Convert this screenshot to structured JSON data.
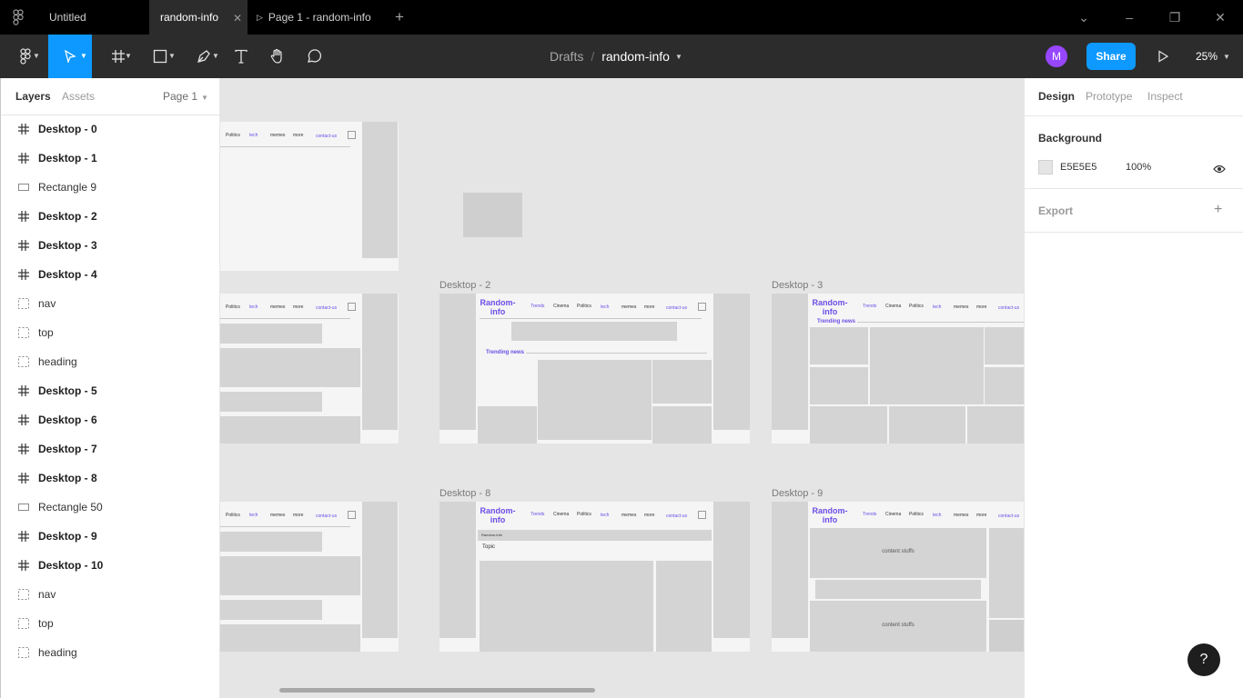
{
  "titlebar": {
    "tabs": [
      "Untitled",
      "random-info",
      "Page 1 - random-info"
    ],
    "close_glyph": "✕",
    "plus_glyph": "+",
    "window_controls": [
      "⌄",
      "–",
      "❐",
      "✕"
    ]
  },
  "toolbar": {
    "breadcrumb_drafts": "Drafts",
    "breadcrumb_sep": "/",
    "file_name": "random-info",
    "avatar_initial": "M",
    "share_label": "Share",
    "zoom": "25%"
  },
  "left_panel": {
    "tab_layers": "Layers",
    "tab_assets": "Assets",
    "page_select": "Page 1",
    "layers": [
      {
        "type": "frame",
        "name": "Desktop - 0"
      },
      {
        "type": "frame",
        "name": "Desktop - 1"
      },
      {
        "type": "rect",
        "name": "Rectangle 9"
      },
      {
        "type": "frame",
        "name": "Desktop - 2"
      },
      {
        "type": "frame",
        "name": "Desktop - 3"
      },
      {
        "type": "frame",
        "name": "Desktop - 4"
      },
      {
        "type": "group",
        "name": "nav"
      },
      {
        "type": "group",
        "name": "top"
      },
      {
        "type": "group",
        "name": "heading"
      },
      {
        "type": "frame",
        "name": "Desktop - 5"
      },
      {
        "type": "frame",
        "name": "Desktop - 6"
      },
      {
        "type": "frame",
        "name": "Desktop - 7"
      },
      {
        "type": "frame",
        "name": "Desktop - 8"
      },
      {
        "type": "rect",
        "name": "Rectangle 50"
      },
      {
        "type": "frame",
        "name": "Desktop - 9"
      },
      {
        "type": "frame",
        "name": "Desktop - 10"
      },
      {
        "type": "group",
        "name": "nav"
      },
      {
        "type": "group",
        "name": "top"
      },
      {
        "type": "group",
        "name": "heading"
      }
    ]
  },
  "canvas": {
    "frame_labels": [
      "Desktop - 2",
      "Desktop - 3",
      "Desktop - 8",
      "Desktop - 9"
    ],
    "nav": {
      "brand_line1": "Random-",
      "brand_line2": "info",
      "items": [
        "Trends",
        "Cinema",
        "Politics",
        "tech",
        "memes",
        "more",
        "contact-us"
      ],
      "short_items": [
        "Politics",
        "tech",
        "memes",
        "more",
        "contact-us"
      ]
    },
    "trending": "Trending news",
    "topic": "Topic",
    "breadcrumb_small": "Random-info",
    "content_label": "content stuffs"
  },
  "right_panel": {
    "tab_design": "Design",
    "tab_prototype": "Prototype",
    "tab_inspect": "Inspect",
    "background_heading": "Background",
    "bg_hex": "E5E5E5",
    "bg_opacity": "100%",
    "export_heading": "Export",
    "export_add": "+"
  },
  "help_label": "?",
  "colors": {
    "accent": "#0d99ff",
    "canvas_bg": "#e5e5e5",
    "brand_purple": "#6c4de6",
    "avatar": "#9747ff"
  }
}
